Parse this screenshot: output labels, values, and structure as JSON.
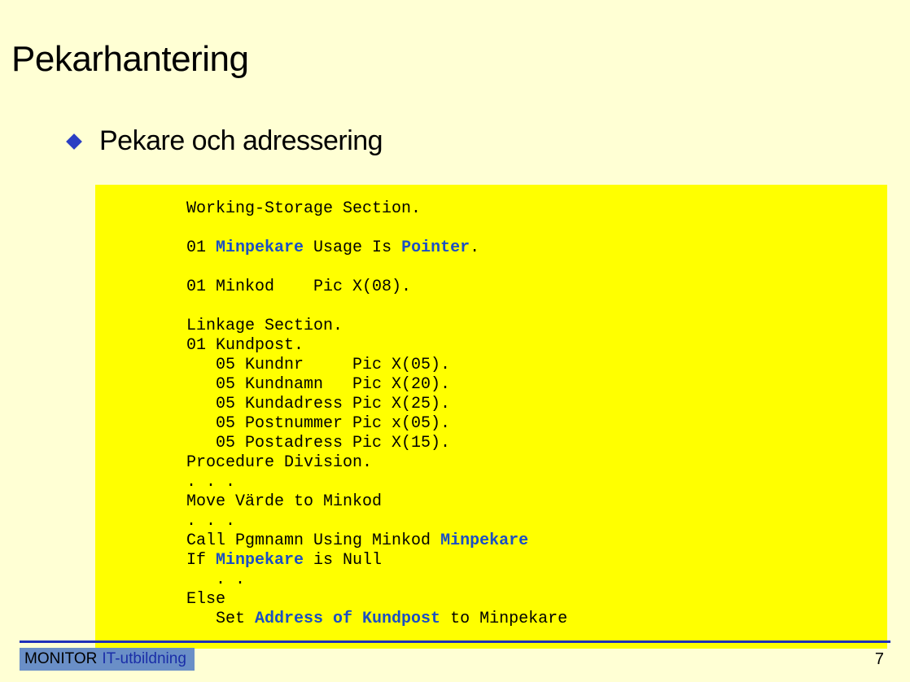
{
  "title": "Pekarhantering",
  "bullet": "Pekare och adressering",
  "code": {
    "l01": "Working-Storage Section.",
    "l02a": "01 ",
    "l02b": "Minpekare",
    "l02c": " Usage Is ",
    "l02d": "Pointer",
    "l02e": ".",
    "l03": "01 Minkod    Pic X(08).",
    "l04": "Linkage Section.",
    "l05": "01 Kundpost.",
    "l06": "   05 Kundnr     Pic X(05).",
    "l07": "   05 Kundnamn   Pic X(20).",
    "l08": "   05 Kundadress Pic X(25).",
    "l09": "   05 Postnummer Pic x(05).",
    "l10": "   05 Postadress Pic X(15).",
    "l11": "Procedure Division.",
    "l12": ". . .",
    "l13": "Move Värde to Minkod",
    "l14": ". . .",
    "l15a": "Call Pgmnamn Using Minkod ",
    "l15b": "Minpekare",
    "l16a": "If ",
    "l16b": "Minpekare",
    "l16c": " is Null",
    "l17": "   . .",
    "l18": "Else",
    "l19a": "   Set ",
    "l19b": "Address of Kundpost",
    "l19c": " to Minpekare"
  },
  "footer": {
    "brand1": "MONITOR",
    "brand2": "IT-utbildning",
    "page": "7"
  }
}
